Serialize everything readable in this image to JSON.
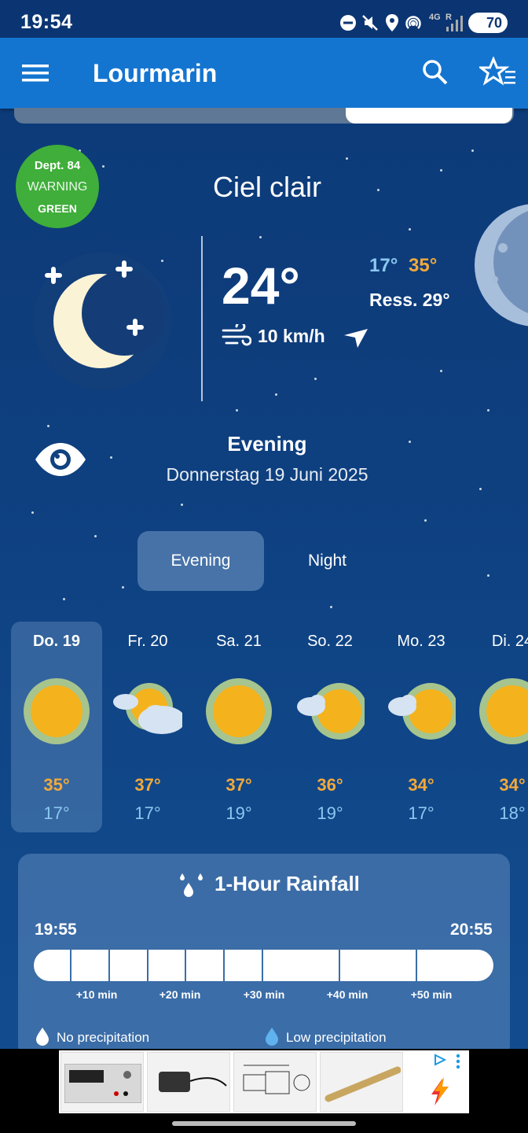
{
  "status_bar": {
    "time": "19:54",
    "network": "4G",
    "roaming": "R",
    "battery": "70"
  },
  "app_bar": {
    "title": "Lourmarin",
    "menu_icon": "menu-icon",
    "search_icon": "search-icon",
    "favorites_icon": "star-list-icon"
  },
  "warning": {
    "dept": "Dept. 84",
    "label": "WARNING",
    "level": "GREEN",
    "color": "#3fae3a"
  },
  "current": {
    "condition": "Ciel clair",
    "temp": "24°",
    "min": "17°",
    "max": "35°",
    "feels_like": "Ress. 29°",
    "wind": "10 km/h",
    "icon": "moon-stars-icon"
  },
  "period": {
    "title": "Evening",
    "date": "Donnerstag 19 Juni 2025"
  },
  "tabs": [
    {
      "label": "Evening",
      "selected": true
    },
    {
      "label": "Night",
      "selected": false
    }
  ],
  "days": [
    {
      "label": "Do. 19",
      "max": "35°",
      "min": "17°",
      "icon": "sun-icon",
      "selected": true
    },
    {
      "label": "Fr. 20",
      "max": "37°",
      "min": "17°",
      "icon": "sun-clouds-icon",
      "selected": false
    },
    {
      "label": "Sa. 21",
      "max": "37°",
      "min": "19°",
      "icon": "sun-icon",
      "selected": false
    },
    {
      "label": "So. 22",
      "max": "36°",
      "min": "19°",
      "icon": "sun-cloud-icon",
      "selected": false
    },
    {
      "label": "Mo. 23",
      "max": "34°",
      "min": "17°",
      "icon": "sun-cloud-icon",
      "selected": false
    },
    {
      "label": "Di. 24",
      "max": "34°",
      "min": "18°",
      "icon": "sun-icon",
      "selected": false
    }
  ],
  "rainfall": {
    "title": "1-Hour Rainfall",
    "start": "19:55",
    "end": "20:55",
    "marks": [
      "+10 min",
      "+20 min",
      "+30 min",
      "+40 min",
      "+50 min"
    ],
    "legend_none": "No precipitation",
    "legend_low": "Low precipitation"
  },
  "colors": {
    "max_temp": "#f2a93b",
    "min_temp": "#8cc8f0",
    "app_bar": "#1475d0"
  }
}
